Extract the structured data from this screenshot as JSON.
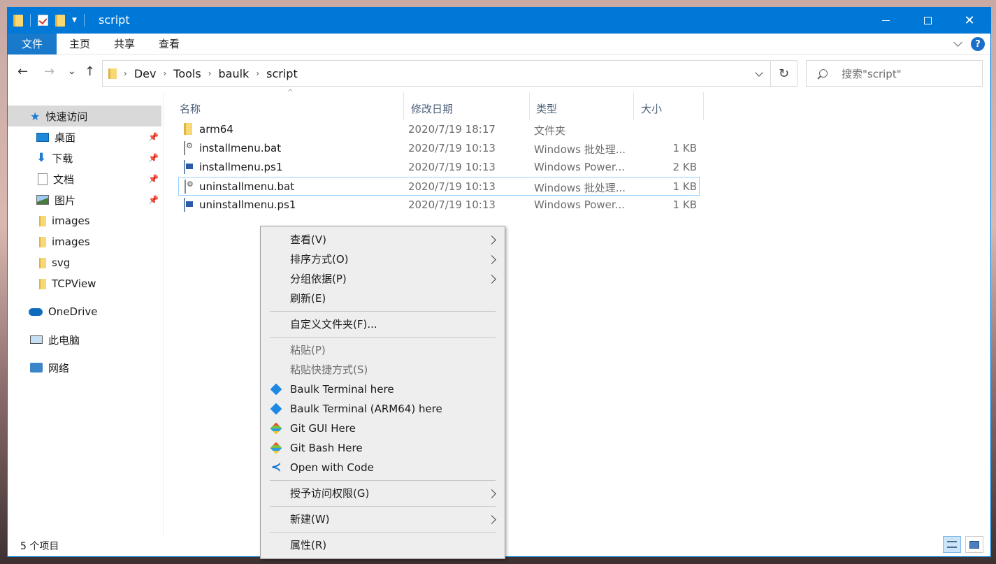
{
  "window": {
    "title": "script",
    "controls": {
      "minimize": "minimize",
      "maximize": "maximize",
      "close": "✕"
    }
  },
  "ribbon": {
    "tabs": [
      "文件",
      "主页",
      "共享",
      "查看"
    ],
    "help": "?"
  },
  "nav": {
    "back": "←",
    "forward": "→",
    "recent": "⌄",
    "up": "↑",
    "breadcrumbs": [
      "Dev",
      "Tools",
      "baulk",
      "script"
    ],
    "refresh": "↻",
    "search_placeholder": "搜索\"script\""
  },
  "sidebar": {
    "items": [
      {
        "label": "快速访问",
        "icon": "star-icon"
      },
      {
        "label": "桌面",
        "icon": "desktop-icon",
        "pinned": true
      },
      {
        "label": "下载",
        "icon": "download-icon",
        "pinned": true
      },
      {
        "label": "文档",
        "icon": "document-icon",
        "pinned": true
      },
      {
        "label": "图片",
        "icon": "pictures-icon",
        "pinned": true
      },
      {
        "label": "images",
        "icon": "folder-icon"
      },
      {
        "label": "images",
        "icon": "folder-icon"
      },
      {
        "label": "svg",
        "icon": "folder-icon"
      },
      {
        "label": "TCPView",
        "icon": "folder-icon"
      },
      {
        "label": "OneDrive",
        "icon": "onedrive-icon"
      },
      {
        "label": "此电脑",
        "icon": "computer-icon"
      },
      {
        "label": "网络",
        "icon": "network-icon"
      }
    ],
    "pin_glyph": "📌"
  },
  "list": {
    "columns": [
      "名称",
      "修改日期",
      "类型",
      "大小"
    ],
    "sort_indicator": "^",
    "files": [
      {
        "name": "arm64",
        "date": "2020/7/19 18:17",
        "type": "文件夹",
        "size": "",
        "icon": "folder-icon"
      },
      {
        "name": "installmenu.bat",
        "date": "2020/7/19 10:13",
        "type": "Windows 批处理...",
        "size": "1 KB",
        "icon": "batch-file-icon"
      },
      {
        "name": "installmenu.ps1",
        "date": "2020/7/19 10:13",
        "type": "Windows Power...",
        "size": "2 KB",
        "icon": "powershell-file-icon"
      },
      {
        "name": "uninstallmenu.bat",
        "date": "2020/7/19 10:13",
        "type": "Windows 批处理...",
        "size": "1 KB",
        "icon": "batch-file-icon",
        "focused": true
      },
      {
        "name": "uninstallmenu.ps1",
        "date": "2020/7/19 10:13",
        "type": "Windows Power...",
        "size": "1 KB",
        "icon": "powershell-file-icon"
      }
    ]
  },
  "status": {
    "item_count": "5 个项目"
  },
  "context_menu": {
    "items": [
      {
        "label": "查看(V)",
        "submenu": true
      },
      {
        "label": "排序方式(O)",
        "submenu": true
      },
      {
        "label": "分组依据(P)",
        "submenu": true
      },
      {
        "label": "刷新(E)"
      },
      {
        "label": "自定义文件夹(F)..."
      },
      {
        "label": "粘贴(P)",
        "disabled": true
      },
      {
        "label": "粘贴快捷方式(S)",
        "disabled": true
      },
      {
        "label": "Baulk Terminal here",
        "icon": "baulk-icon"
      },
      {
        "label": "Baulk Terminal (ARM64) here",
        "icon": "baulk-icon"
      },
      {
        "label": "Git GUI Here",
        "icon": "git-icon"
      },
      {
        "label": "Git Bash Here",
        "icon": "git-icon"
      },
      {
        "label": "Open with Code",
        "icon": "vscode-icon"
      },
      {
        "label": "授予访问权限(G)",
        "submenu": true
      },
      {
        "label": "新建(W)",
        "submenu": true
      },
      {
        "label": "属性(R)"
      }
    ]
  },
  "colors": {
    "accent": "#0078d7",
    "selection": "#d9d9d9",
    "focus_border": "#99d1ff",
    "menu_bg": "#eeeeee"
  }
}
